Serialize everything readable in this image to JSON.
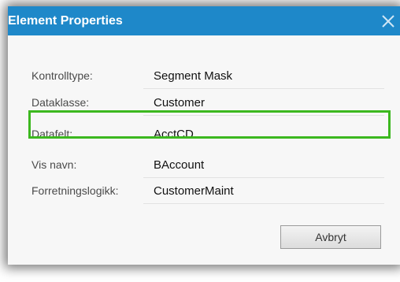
{
  "dialog": {
    "title": "Element Properties",
    "close_icon": "close-icon",
    "accent_color": "#1e88c9",
    "highlight_color": "#3cb81f"
  },
  "properties": [
    {
      "label": "Kontrolltype:",
      "value": "Segment Mask"
    },
    {
      "label": "Dataklasse:",
      "value": "Customer"
    },
    {
      "label": "Datafelt:",
      "value": "AcctCD"
    },
    {
      "label": "Vis navn:",
      "value": "BAccount"
    },
    {
      "label": "Forretningslogikk:",
      "value": "CustomerMaint"
    }
  ],
  "buttons": {
    "cancel_label": "Avbryt"
  }
}
